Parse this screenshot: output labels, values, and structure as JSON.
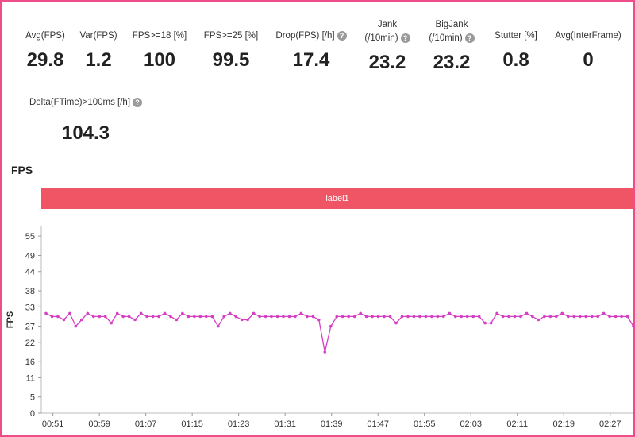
{
  "metrics": [
    {
      "label": "Avg(FPS)",
      "value": "29.8"
    },
    {
      "label": "Var(FPS)",
      "value": "1.2"
    },
    {
      "label": "FPS>=18 [%]",
      "value": "100"
    },
    {
      "label": "FPS>=25 [%]",
      "value": "99.5"
    },
    {
      "label": "Drop(FPS) [/h]",
      "value": "17.4"
    },
    {
      "label_line1": "Jank",
      "label_line2": "(/10min)",
      "value": "23.2"
    },
    {
      "label_line1": "BigJank",
      "label_line2": "(/10min)",
      "value": "23.2"
    },
    {
      "label": "Stutter [%]",
      "value": "0.8"
    },
    {
      "label": "Avg(InterFrame)",
      "value": "0"
    },
    {
      "label": "Delta(FTime)>100ms [/h]",
      "value": "104.3"
    }
  ],
  "help_icon": "question-circle-icon",
  "section_title": "FPS",
  "label_bar": {
    "text": "label1",
    "color": "#ef5564"
  },
  "accent_color": "#ef4d8a",
  "chart_data": {
    "type": "line",
    "title": "",
    "xlabel": "",
    "ylabel": "FPS",
    "ylim": [
      0,
      58
    ],
    "yticks": [
      0,
      5,
      11,
      16,
      22,
      27,
      33,
      38,
      44,
      49,
      55
    ],
    "xtick_labels": [
      "00:51",
      "00:59",
      "01:07",
      "01:15",
      "01:23",
      "01:31",
      "01:39",
      "01:47",
      "01:55",
      "02:03",
      "02:11",
      "02:19",
      "02:27"
    ],
    "x_range_seconds": [
      "00:49",
      "02:31"
    ],
    "series": [
      {
        "color": "#d63fc4",
        "values": [
          31,
          30,
          30,
          29,
          31,
          27,
          29,
          31,
          30,
          30,
          30,
          28,
          31,
          30,
          30,
          29,
          31,
          30,
          30,
          30,
          31,
          30,
          29,
          31,
          30,
          30,
          30,
          30,
          30,
          27,
          30,
          31,
          30,
          29,
          29,
          31,
          30,
          30,
          30,
          30,
          30,
          30,
          30,
          31,
          30,
          30,
          29,
          19,
          27,
          30,
          30,
          30,
          30,
          31,
          30,
          30,
          30,
          30,
          30,
          28,
          30,
          30,
          30,
          30,
          30,
          30,
          30,
          30,
          31,
          30,
          30,
          30,
          30,
          30,
          28,
          28,
          31,
          30,
          30,
          30,
          30,
          31,
          30,
          29,
          30,
          30,
          30,
          31,
          30,
          30,
          30,
          30,
          30,
          30,
          31,
          30,
          30,
          30,
          30,
          27
        ]
      }
    ]
  }
}
